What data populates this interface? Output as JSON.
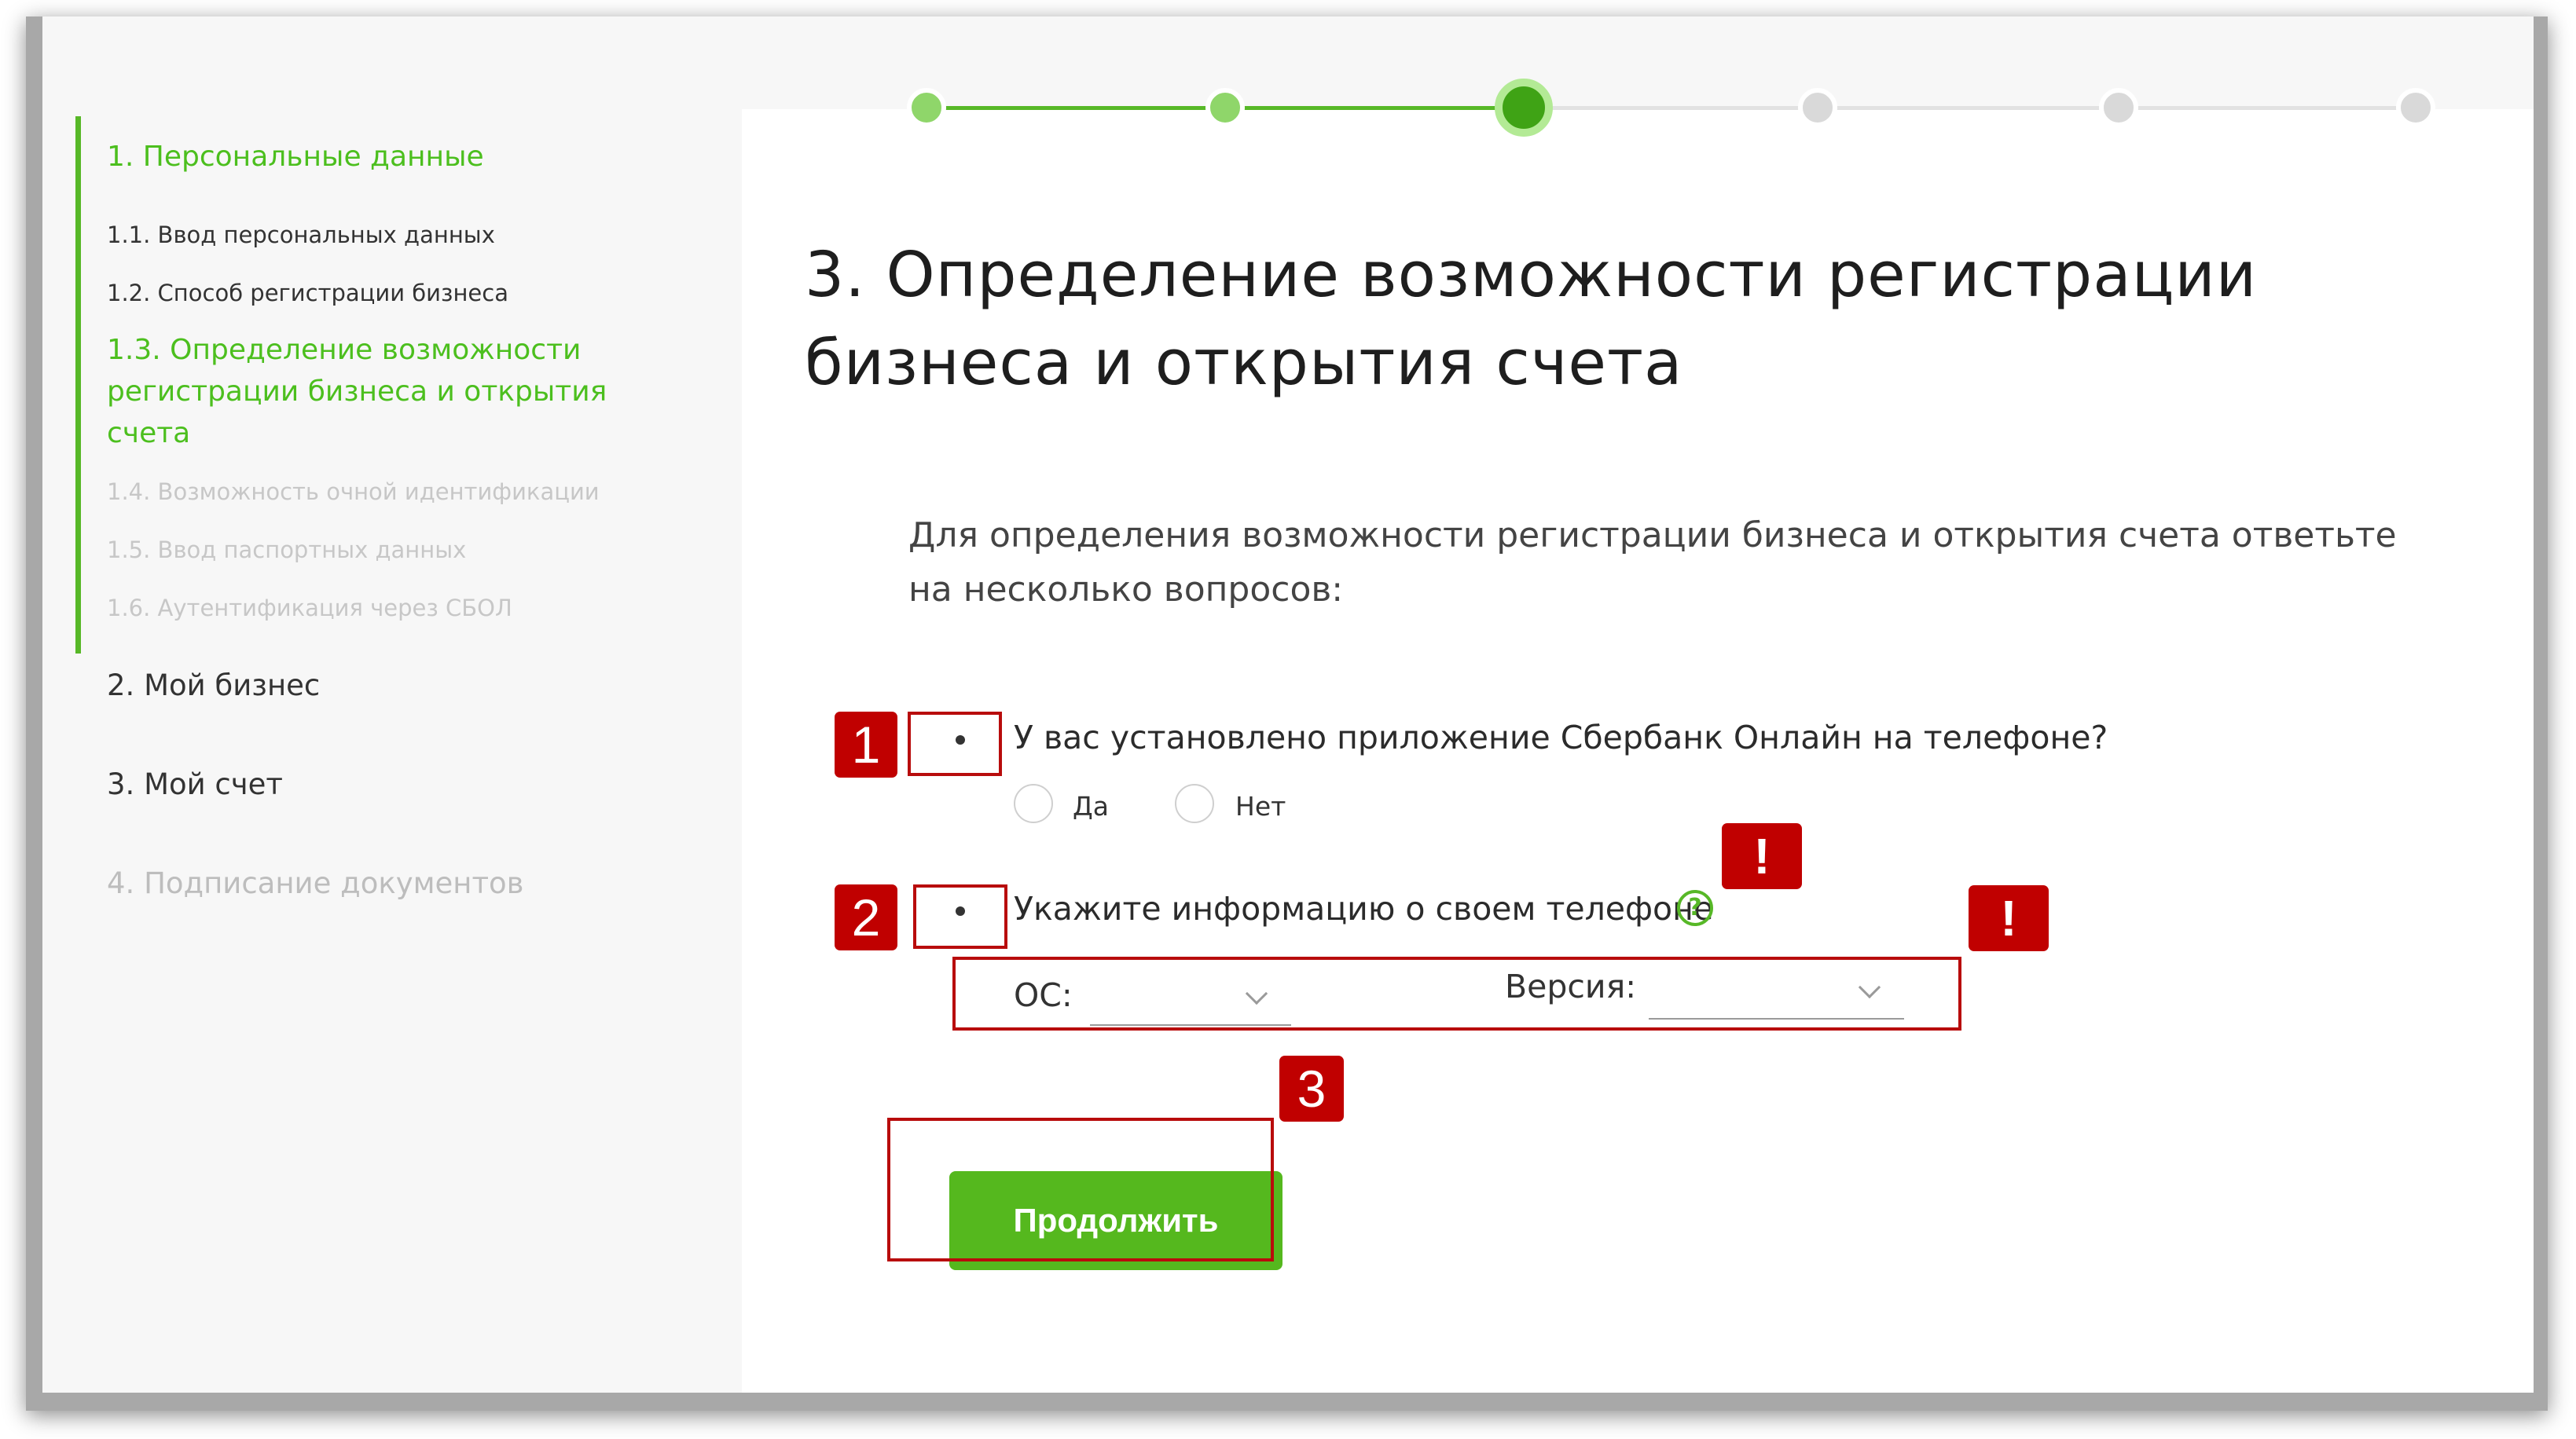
{
  "sidebar": {
    "section_1": "1. Персональные данные",
    "items": [
      {
        "label": "1.1. Ввод персональных данных",
        "state": "completed"
      },
      {
        "label": "1.2. Способ регистрации бизнеса",
        "state": "completed"
      },
      {
        "label": "1.3. Определение возможности регистрации бизнеса и открытия счета",
        "state": "current"
      },
      {
        "label": "1.4. Возможность очной идентификации",
        "state": "disabled"
      },
      {
        "label": "1.5. Ввод паспортных данных",
        "state": "disabled"
      },
      {
        "label": "1.6. Аутентификация через СБОЛ",
        "state": "disabled"
      }
    ],
    "section_2": "2. Мой бизнес",
    "section_3": "3. Мой счет",
    "section_4": "4. Подписание документов"
  },
  "stepper": {
    "total_steps": 6,
    "completed_steps": 2,
    "current_step": 3
  },
  "main": {
    "title_line1": "3. Определение возможности регистрации",
    "title_line2": "бизнеса и открытия счета",
    "intro_line1": "Для определения возможности регистрации бизнеса и открытия счета ответьте",
    "intro_line2": "на несколько вопросов:",
    "question_1": {
      "bullet": "•",
      "text": "У вас установлено приложение Сбербанк Онлайн на телефоне?",
      "options": [
        "Да",
        "Нет"
      ]
    },
    "question_2": {
      "bullet": "•",
      "text": "Укажите информацию о своем телефоне",
      "help_icon": "?",
      "os_label": "ОС:",
      "os_value": "",
      "version_label": "Версия:",
      "version_value": ""
    },
    "continue_label": "Продолжить"
  },
  "annotations": {
    "markers": [
      "1",
      "2",
      "3"
    ],
    "warning": "!"
  },
  "colors": {
    "accent_green": "#57b827",
    "button_green": "#55b81e",
    "annotation_red": "#c00000",
    "disabled_text": "#c7c7c7"
  },
  "icons": [
    "question-circle-icon",
    "chevron-down-icon",
    "radio-button-icon"
  ]
}
